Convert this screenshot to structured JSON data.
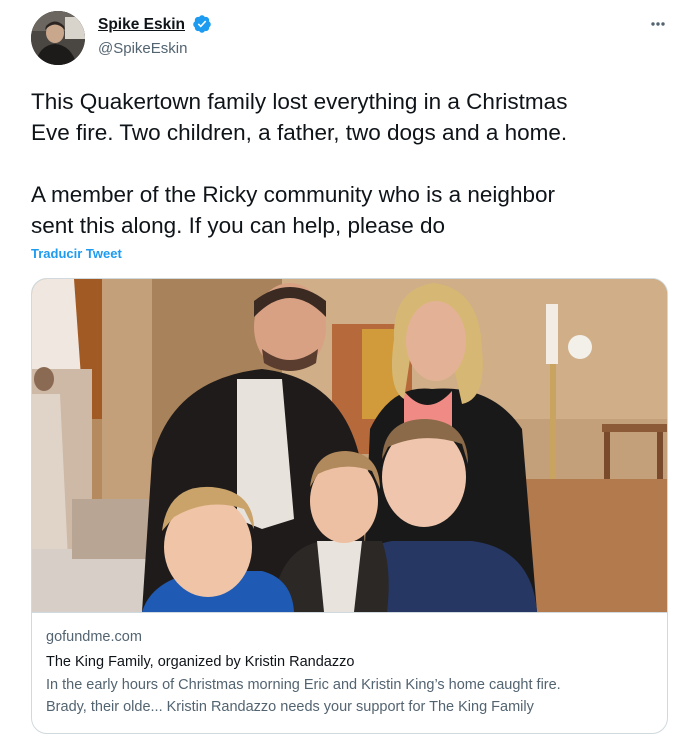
{
  "tweet": {
    "author": {
      "name": "Spike Eskin",
      "handle": "@SpikeEskin",
      "verified": true,
      "verified_color": "#1d9bf0"
    },
    "more_icon": "ellipsis-icon",
    "text_lines": [
      "This Quakertown family lost everything in a Christmas",
      "Eve fire. Two children, a father, two dogs and a home.",
      "A member of the Ricky community who is a neighbor",
      "sent this along. If you can help, please do"
    ],
    "translate_label": "Traducir Tweet",
    "card": {
      "domain": "gofundme.com",
      "title": "The King Family, organized by Kristin Randazzo",
      "description_lines": [
        "In the early hours of Christmas morning Eric and Kristin King’s home caught fire.",
        "Brady, their olde... Kristin Randazzo needs your support for The King Family"
      ]
    }
  },
  "colors": {
    "text": "#0f1419",
    "secondary": "#536471",
    "link": "#1d9bf0",
    "border": "#cfd9de"
  }
}
